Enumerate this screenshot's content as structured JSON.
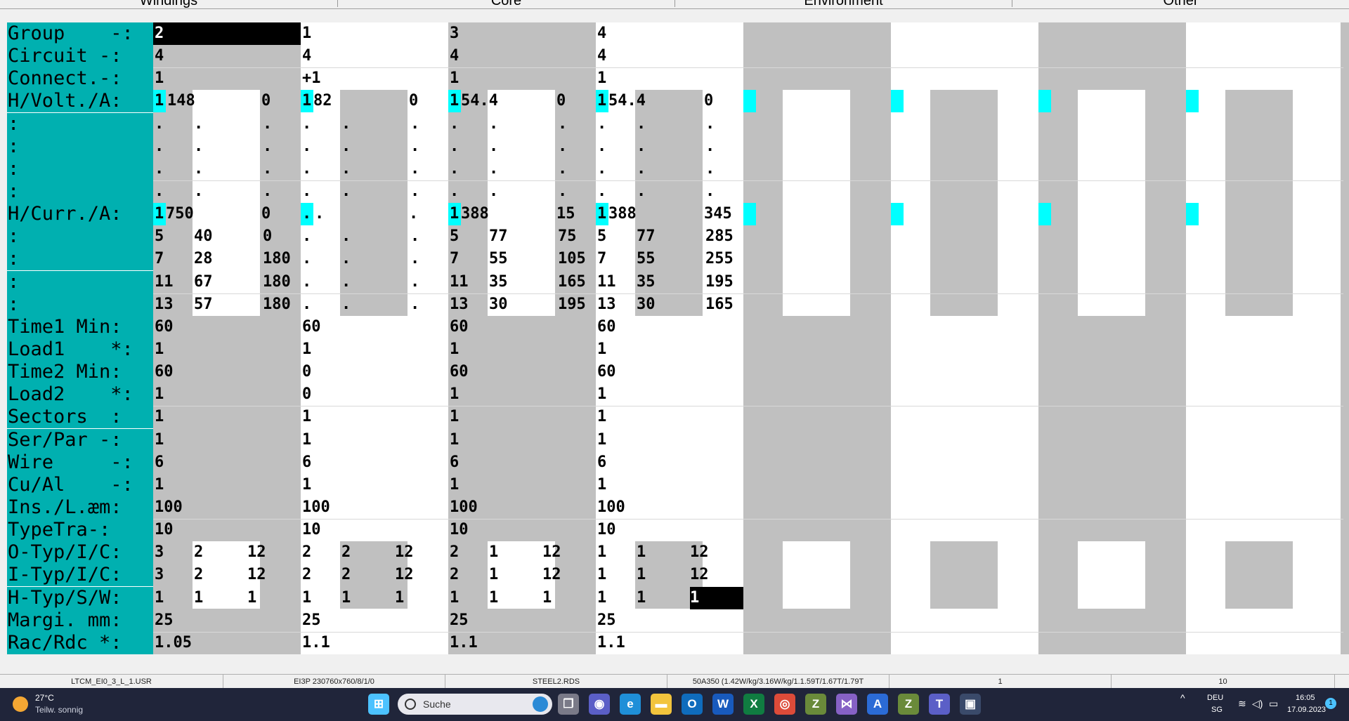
{
  "tabs": [
    "Windings",
    "Core",
    "Environment",
    "Other"
  ],
  "labels": [
    "Group    -:",
    "Circuit -:",
    "Connect.-:",
    "H/Volt./A:",
    ":",
    ":",
    ":",
    ":",
    "H/Curr./A:",
    ":",
    ":",
    ":",
    ":",
    "Time1 Min:",
    "Load1    *:",
    "Time2 Min:",
    "Load2    *:",
    "Sectors  :",
    "Ser/Par -:",
    "Wire     -:",
    "Cu/Al    -:",
    "Ins./L.æm:",
    "TypeTra-:",
    "O-Typ/I/C:",
    "I-Typ/I/C:",
    "H-Typ/S/W:",
    "Margi. mm:",
    "Rac/Rdc *:"
  ],
  "columns": [
    {
      "group": "2",
      "circuit": "4",
      "connect": "1",
      "hvolt": [
        "1",
        "148",
        "0"
      ],
      "hvolt_rows": [
        [
          ".",
          ".",
          "."
        ],
        [
          ".",
          ".",
          "."
        ],
        [
          ".",
          ".",
          "."
        ],
        [
          ".",
          ".",
          "."
        ]
      ],
      "hcurr": [
        "1",
        "750",
        "0"
      ],
      "hcurr_rows": [
        [
          "5",
          "40",
          "0"
        ],
        [
          "7",
          "28",
          "180"
        ],
        [
          "11",
          "67",
          "180"
        ],
        [
          "13",
          "57",
          "180"
        ]
      ],
      "time1": "60",
      "load1": "1",
      "time2": "60",
      "load2": "1",
      "sectors": "1",
      "serpar": "1",
      "wire": "6",
      "cual": "1",
      "ins": "100",
      "typetra": "10",
      "otyp": [
        "3",
        "2",
        "12"
      ],
      "ityp": [
        "3",
        "2",
        "12"
      ],
      "htyp": [
        "1",
        "1",
        "1"
      ],
      "margi": "25",
      "racrdc": "1.05"
    },
    {
      "group": "1",
      "circuit": "4",
      "connect": "+1",
      "hvolt": [
        "1",
        "82",
        "0"
      ],
      "hvolt_rows": [
        [
          ".",
          ".",
          "."
        ],
        [
          ".",
          ".",
          "."
        ],
        [
          ".",
          ".",
          "."
        ],
        [
          ".",
          ".",
          "."
        ]
      ],
      "hcurr": [
        ".",
        ".",
        "."
      ],
      "hcurr_rows": [
        [
          ".",
          ".",
          "."
        ],
        [
          ".",
          ".",
          "."
        ],
        [
          ".",
          ".",
          "."
        ],
        [
          ".",
          ".",
          "."
        ]
      ],
      "time1": "60",
      "load1": "1",
      "time2": "0",
      "load2": "0",
      "sectors": "1",
      "serpar": "1",
      "wire": "6",
      "cual": "1",
      "ins": "100",
      "typetra": "10",
      "otyp": [
        "2",
        "2",
        "12"
      ],
      "ityp": [
        "2",
        "2",
        "12"
      ],
      "htyp": [
        "1",
        "1",
        "1"
      ],
      "margi": "25",
      "racrdc": "1.1"
    },
    {
      "group": "3",
      "circuit": "4",
      "connect": "1",
      "hvolt": [
        "1",
        "54.4",
        "0"
      ],
      "hvolt_rows": [
        [
          ".",
          ".",
          "."
        ],
        [
          ".",
          ".",
          "."
        ],
        [
          ".",
          ".",
          "."
        ],
        [
          ".",
          ".",
          "."
        ]
      ],
      "hcurr": [
        "1",
        "388",
        "15"
      ],
      "hcurr_rows": [
        [
          "5",
          "77",
          "75"
        ],
        [
          "7",
          "55",
          "105"
        ],
        [
          "11",
          "35",
          "165"
        ],
        [
          "13",
          "30",
          "195"
        ]
      ],
      "time1": "60",
      "load1": "1",
      "time2": "60",
      "load2": "1",
      "sectors": "1",
      "serpar": "1",
      "wire": "6",
      "cual": "1",
      "ins": "100",
      "typetra": "10",
      "otyp": [
        "2",
        "1",
        "12"
      ],
      "ityp": [
        "2",
        "1",
        "12"
      ],
      "htyp": [
        "1",
        "1",
        "1"
      ],
      "margi": "25",
      "racrdc": "1.1"
    },
    {
      "group": "4",
      "circuit": "4",
      "connect": "1",
      "hvolt": [
        "1",
        "54.4",
        "0"
      ],
      "hvolt_rows": [
        [
          ".",
          ".",
          "."
        ],
        [
          ".",
          ".",
          "."
        ],
        [
          ".",
          ".",
          "."
        ],
        [
          ".",
          ".",
          "."
        ]
      ],
      "hcurr": [
        "1",
        "388",
        "345"
      ],
      "hcurr_rows": [
        [
          "5",
          "77",
          "285"
        ],
        [
          "7",
          "55",
          "255"
        ],
        [
          "11",
          "35",
          "195"
        ],
        [
          "13",
          "30",
          "165"
        ]
      ],
      "time1": "60",
      "load1": "1",
      "time2": "60",
      "load2": "1",
      "sectors": "1",
      "serpar": "1",
      "wire": "6",
      "cual": "1",
      "ins": "100",
      "typetra": "10",
      "otyp": [
        "1",
        "1",
        "12"
      ],
      "ityp": [
        "1",
        "1",
        "12"
      ],
      "htyp": [
        "1",
        "1",
        "1"
      ],
      "margi": "25",
      "racrdc": "1.1"
    }
  ],
  "statusbar": [
    "LTCM_EI0_3_L_1.USR",
    "EI3P 230760x760/8/1/0",
    "STEEL2.RDS",
    "50A350 (1.42W/kg/3.16W/kg/1.1.59T/1.67T/1.79T",
    "1",
    "10"
  ],
  "taskbar": {
    "weather_temp": "27°C",
    "weather_desc": "Teilw. sonnig",
    "search_placeholder": "Suche",
    "lang": "DEU",
    "region": "SG",
    "time": "16:05",
    "date": "17.09.2023",
    "notification_count": "1",
    "apps": [
      {
        "name": "start",
        "color": "#4cc2ff",
        "glyph": "⊞"
      },
      {
        "name": "task-view",
        "color": "#7a7a88",
        "glyph": "❐"
      },
      {
        "name": "meet",
        "color": "#5b5fc7",
        "glyph": "◉"
      },
      {
        "name": "edge",
        "color": "#1f8fd8",
        "glyph": "e"
      },
      {
        "name": "explorer",
        "color": "#f2c43d",
        "glyph": "▬"
      },
      {
        "name": "outlook",
        "color": "#0f6cbd",
        "glyph": "O"
      },
      {
        "name": "word",
        "color": "#185abd",
        "glyph": "W"
      },
      {
        "name": "excel",
        "color": "#107c41",
        "glyph": "X"
      },
      {
        "name": "chrome",
        "color": "#dd4b39",
        "glyph": "◎"
      },
      {
        "name": "z-app-1",
        "color": "#6a8a3a",
        "glyph": "Z"
      },
      {
        "name": "visual-studio",
        "color": "#8661c5",
        "glyph": "⋈"
      },
      {
        "name": "a-app",
        "color": "#2b6bd6",
        "glyph": "A"
      },
      {
        "name": "z-app-2",
        "color": "#6a8a3a",
        "glyph": "Z"
      },
      {
        "name": "teams",
        "color": "#5b5fc7",
        "glyph": "T"
      },
      {
        "name": "active-app",
        "color": "#3a4a6a",
        "glyph": "▣"
      }
    ]
  }
}
